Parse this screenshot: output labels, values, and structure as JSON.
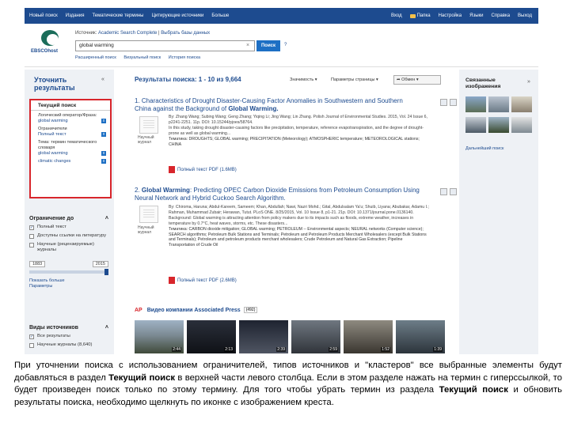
{
  "topnav": {
    "left": [
      "Новый поиск",
      "Издания",
      "Тематические термины",
      "Цитирующие источники",
      "Больше"
    ],
    "right": [
      "Вход",
      "Папка",
      "Настройка",
      "Языки",
      "Справка",
      "Выход"
    ]
  },
  "header": {
    "logo_text": "EBSCOhost",
    "searching_label": "Источник:",
    "database": "Academic Search Complete",
    "choose_db": "Выбрать базы данных",
    "query": "global warming",
    "search_button": "Поиск",
    "help": "?",
    "sublinks": [
      "Расширенный поиск",
      "Визуальный поиск",
      "История поиска"
    ]
  },
  "left": {
    "refine_title": "Уточнить результаты",
    "current_search": {
      "title": "Текущий поиск",
      "items": [
        {
          "label": "Логический оператор/Фраза:",
          "value": "global warming"
        },
        {
          "label": "Ограничители",
          "value": "Полный текст"
        },
        {
          "label": "Тема: термин тематического словаря",
          "value": "global warming"
        },
        {
          "label": "",
          "value": "climatic changes"
        }
      ]
    },
    "limit": {
      "title": "Ограничение до",
      "items": [
        "Полный текст",
        "Доступны ссылки на литературу",
        "Научные (рецензируемые) журналы"
      ],
      "checked": [
        true,
        false,
        false
      ],
      "date_from": "1883",
      "date_to": "2015",
      "show_more": "Показать больше",
      "options": "Параметры"
    },
    "sources": {
      "title": "Виды источников",
      "items": [
        "Все результаты",
        "Научные журналы (8,640)"
      ],
      "checked": [
        true,
        false
      ]
    }
  },
  "results": {
    "header_label": "Результаты поиска:",
    "range": "1 - 10 из 9,664",
    "relevance": "Значимость",
    "page_options": "Параметры страницы",
    "share": "Обмен",
    "items": [
      {
        "num": "1.",
        "title_pre": "Characteristics of Drought Disaster-Causing Factor Anomalies in Southwestern and Southern China against the Background of ",
        "title_bold": "Global Warming.",
        "thumb_label": "Научный журнал",
        "body1": "By: Zhang Wang; Subing Wang; Geng Zhang; Yiqing Li; Jing Wang; Lin Zhang. Polish Journal of Environmental Studies. 2015, Vol. 24 Issue 6, p2241-2251. 11p. DOI: 10.15244/pjoes/58764.",
        "body2": "In this study, taking drought disaster-causing factors like precipitation, temperature, reference evapotranspiration, and the degree of drought-prone as well as global warming...",
        "subjects": "Тематика: DROUGHTS; GLOBAL warming; PRECIPITATION (Meteorology); ATMOSPHERIC temperature; METEOROLOGICAL stations; CHINA",
        "pdf": "Полный текст PDF (1.6MB)"
      },
      {
        "num": "2.",
        "title_pre": "",
        "title_bold": "Global Warming",
        "title_post": ": Predicting OPEC Carbon Dioxide Emissions from Petroleum Consumption Using Neural Network and Hybrid Cuckoo Search Algorithm.",
        "thumb_label": "Научный журнал",
        "body1": "By: Chiroma, Haruna; Abdul-Kareem, Sameem; Khan, Abdullah; Nawi, Nazri Mohd.; Gital, Abdulsalam Ya'u; Shuib, Liyana; Abubakar, Adamu I.; Rahman, Muhammad Zubair; Herawan, Tutut. PLoS ONE. 8/25/2015, Vol. 10 Issue 8, p1-21. 21p. DOI: 10.1371/journal.pone.0136140.",
        "body2": "Background: Global warming is attracting attention from policy makers due to its impacts such as floods, extreme weather, increases in temperature by 0.7°C, heat waves, storms, etc. These disasters...",
        "subjects": "Тематика: CARBON dioxide mitigation; GLOBAL warming; PETROLEUM -- Environmental aspects; NEURAL networks (Computer science); SEARCH algorithms; Petroleum Bulk Stations and Terminals; Petroleum and Petroleum Products Merchant Wholesalers (except Bulk Stations and Terminals); Petroleum and petroleum products merchant wholesalers; Crude Petroleum and Natural Gas Extraction; Pipeline Transportation of Crude Oil",
        "pdf": "Полный текст PDF (2.6MB)"
      }
    ]
  },
  "right": {
    "related_title": "Связанные изображения",
    "more_images": "Дальнейший поиск"
  },
  "video": {
    "logo": "AP",
    "title": "Видео компании Associated Press",
    "count": "(492)",
    "durations": [
      "2:44",
      "2:13",
      "2:39",
      "2:59",
      "1:52",
      "1:39"
    ]
  },
  "caption": {
    "p1_a": "При уточнении поиска с использованием ограничителей, типов источников и \"кластеров\" все выбранные элементы будут добавляться в раздел ",
    "p1_b": "Текущий поиск",
    "p1_c": " в верхней части левого столбца. Если в этом разделе нажать на термин с гиперссылкой, то будет произведен поиск только по этому термину. Для того чтобы убрать термин из раздела ",
    "p1_d": "Текущий поиск",
    "p1_e": " и обновить результаты поиска, необходимо щелкнуть по иконке с изображением креста."
  }
}
